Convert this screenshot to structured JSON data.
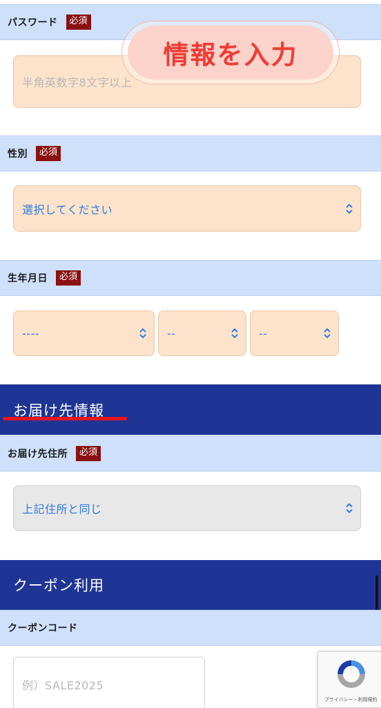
{
  "password": {
    "label": "パスワード",
    "required": "必須",
    "placeholder": "半角英数字8文字以上"
  },
  "callout": {
    "text": "情報を入力"
  },
  "gender": {
    "label": "性別",
    "required": "必須",
    "value": "選択してください"
  },
  "birthdate": {
    "label": "生年月日",
    "required": "必須",
    "year": "----",
    "month": "--",
    "day": "--"
  },
  "delivery_section": {
    "title": "お届け先情報",
    "underline_color": "#e8151c"
  },
  "delivery_address": {
    "label": "お届け先住所",
    "required": "必須",
    "value": "上記住所と同じ"
  },
  "coupon_section": {
    "title": "クーポン利用"
  },
  "coupon_code": {
    "label": "クーポンコード",
    "placeholder": "例）SALE2025"
  },
  "recaptcha": {
    "links": "プライバシー・利用規約"
  },
  "colors": {
    "label_bar": "#cfe0fb",
    "required_badge": "#8b1010",
    "field_fill": "#fde3cb",
    "section_bar": "#1f3595",
    "value_text": "#2c7be5"
  },
  "icons": {
    "select_chevron": "chevron-up-down-icon",
    "recaptcha_logo": "recaptcha-logo-icon"
  }
}
